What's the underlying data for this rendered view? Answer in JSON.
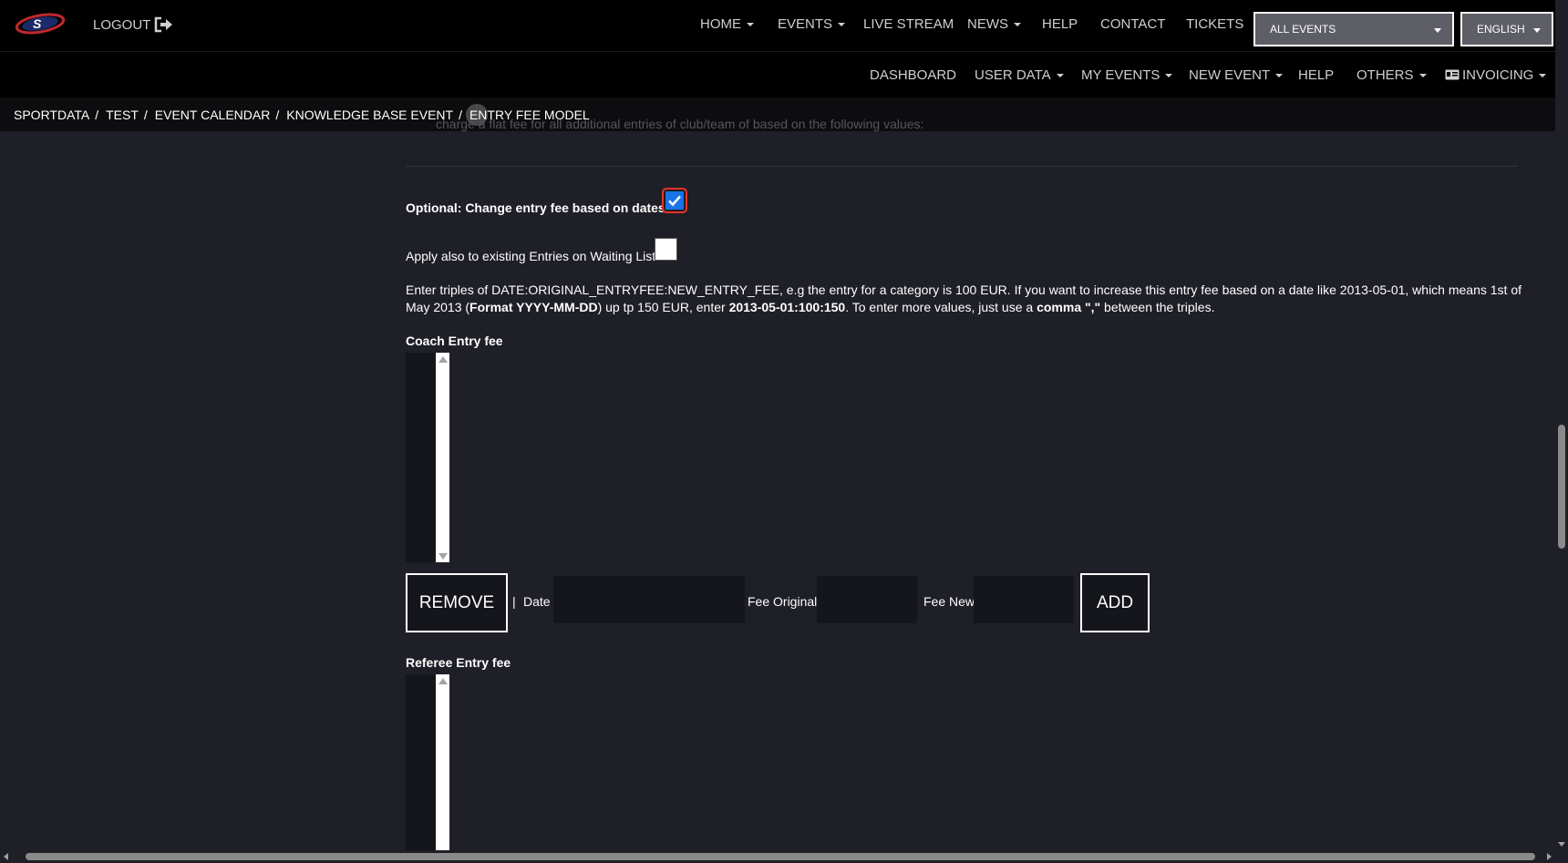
{
  "header": {
    "logout_label": "LOGOUT",
    "nav": [
      {
        "label": "HOME",
        "dropdown": true
      },
      {
        "label": "EVENTS",
        "dropdown": true
      },
      {
        "label": "LIVE STREAM",
        "dropdown": false
      },
      {
        "label": "NEWS",
        "dropdown": true
      },
      {
        "label": "HELP",
        "dropdown": false
      },
      {
        "label": "CONTACT",
        "dropdown": false
      },
      {
        "label": "TICKETS",
        "dropdown": false
      }
    ],
    "events_select": "ALL EVENTS",
    "language_select": "ENGLISH"
  },
  "subnav": [
    {
      "label": "DASHBOARD",
      "dropdown": false
    },
    {
      "label": "USER DATA",
      "dropdown": true
    },
    {
      "label": "MY EVENTS",
      "dropdown": true
    },
    {
      "label": "NEW EVENT",
      "dropdown": true
    },
    {
      "label": "HELP",
      "dropdown": false
    },
    {
      "label": "OTHERS",
      "dropdown": true
    },
    {
      "label": "INVOICING",
      "dropdown": true,
      "icon": "id-card-icon"
    }
  ],
  "breadcrumb": [
    "SPORTDATA",
    "TEST",
    "EVENT CALENDAR",
    "KNOWLEDGE BASE EVENT",
    "ENTRY FEE MODEL"
  ],
  "faded_text": "charge a flat fee for all additional entries of club/team of based on the following values:",
  "form": {
    "optional_label": "Optional: Change entry fee based on dates",
    "optional_checked": true,
    "waiting_list_label": "Apply also to existing Entries on Waiting List",
    "waiting_list_checked": false,
    "info": {
      "t1": "Enter triples of DATE:ORIGINAL_ENTRYFEE:NEW_ENTRY_FEE, e.g the entry for a category is 100 EUR. If you want to increase this entry fee based on a date like 2013-05-01, which means 1st of May 2013 (",
      "b1": "Format YYYY-MM-DD",
      "t2": ") up tp 150 EUR, enter ",
      "b2": "2013-05-01:100:150",
      "t3": ". To enter more values, just use a ",
      "b3": "comma \",\"",
      "t4": " between the triples."
    },
    "coach_title": "Coach Entry fee",
    "referee_title": "Referee Entry fee",
    "remove_label": "REMOVE",
    "separator": "|",
    "date_label": "Date",
    "date_value": "",
    "fee_original_label": "Fee Original",
    "fee_original_value": "",
    "fee_new_label": "Fee New",
    "fee_new_value": "",
    "add_label": "ADD"
  },
  "colors": {
    "background": "#1e1f27",
    "navbar": "#000000",
    "checkbox_accent": "#1a73e8",
    "select_bg": "#5d5e66"
  }
}
